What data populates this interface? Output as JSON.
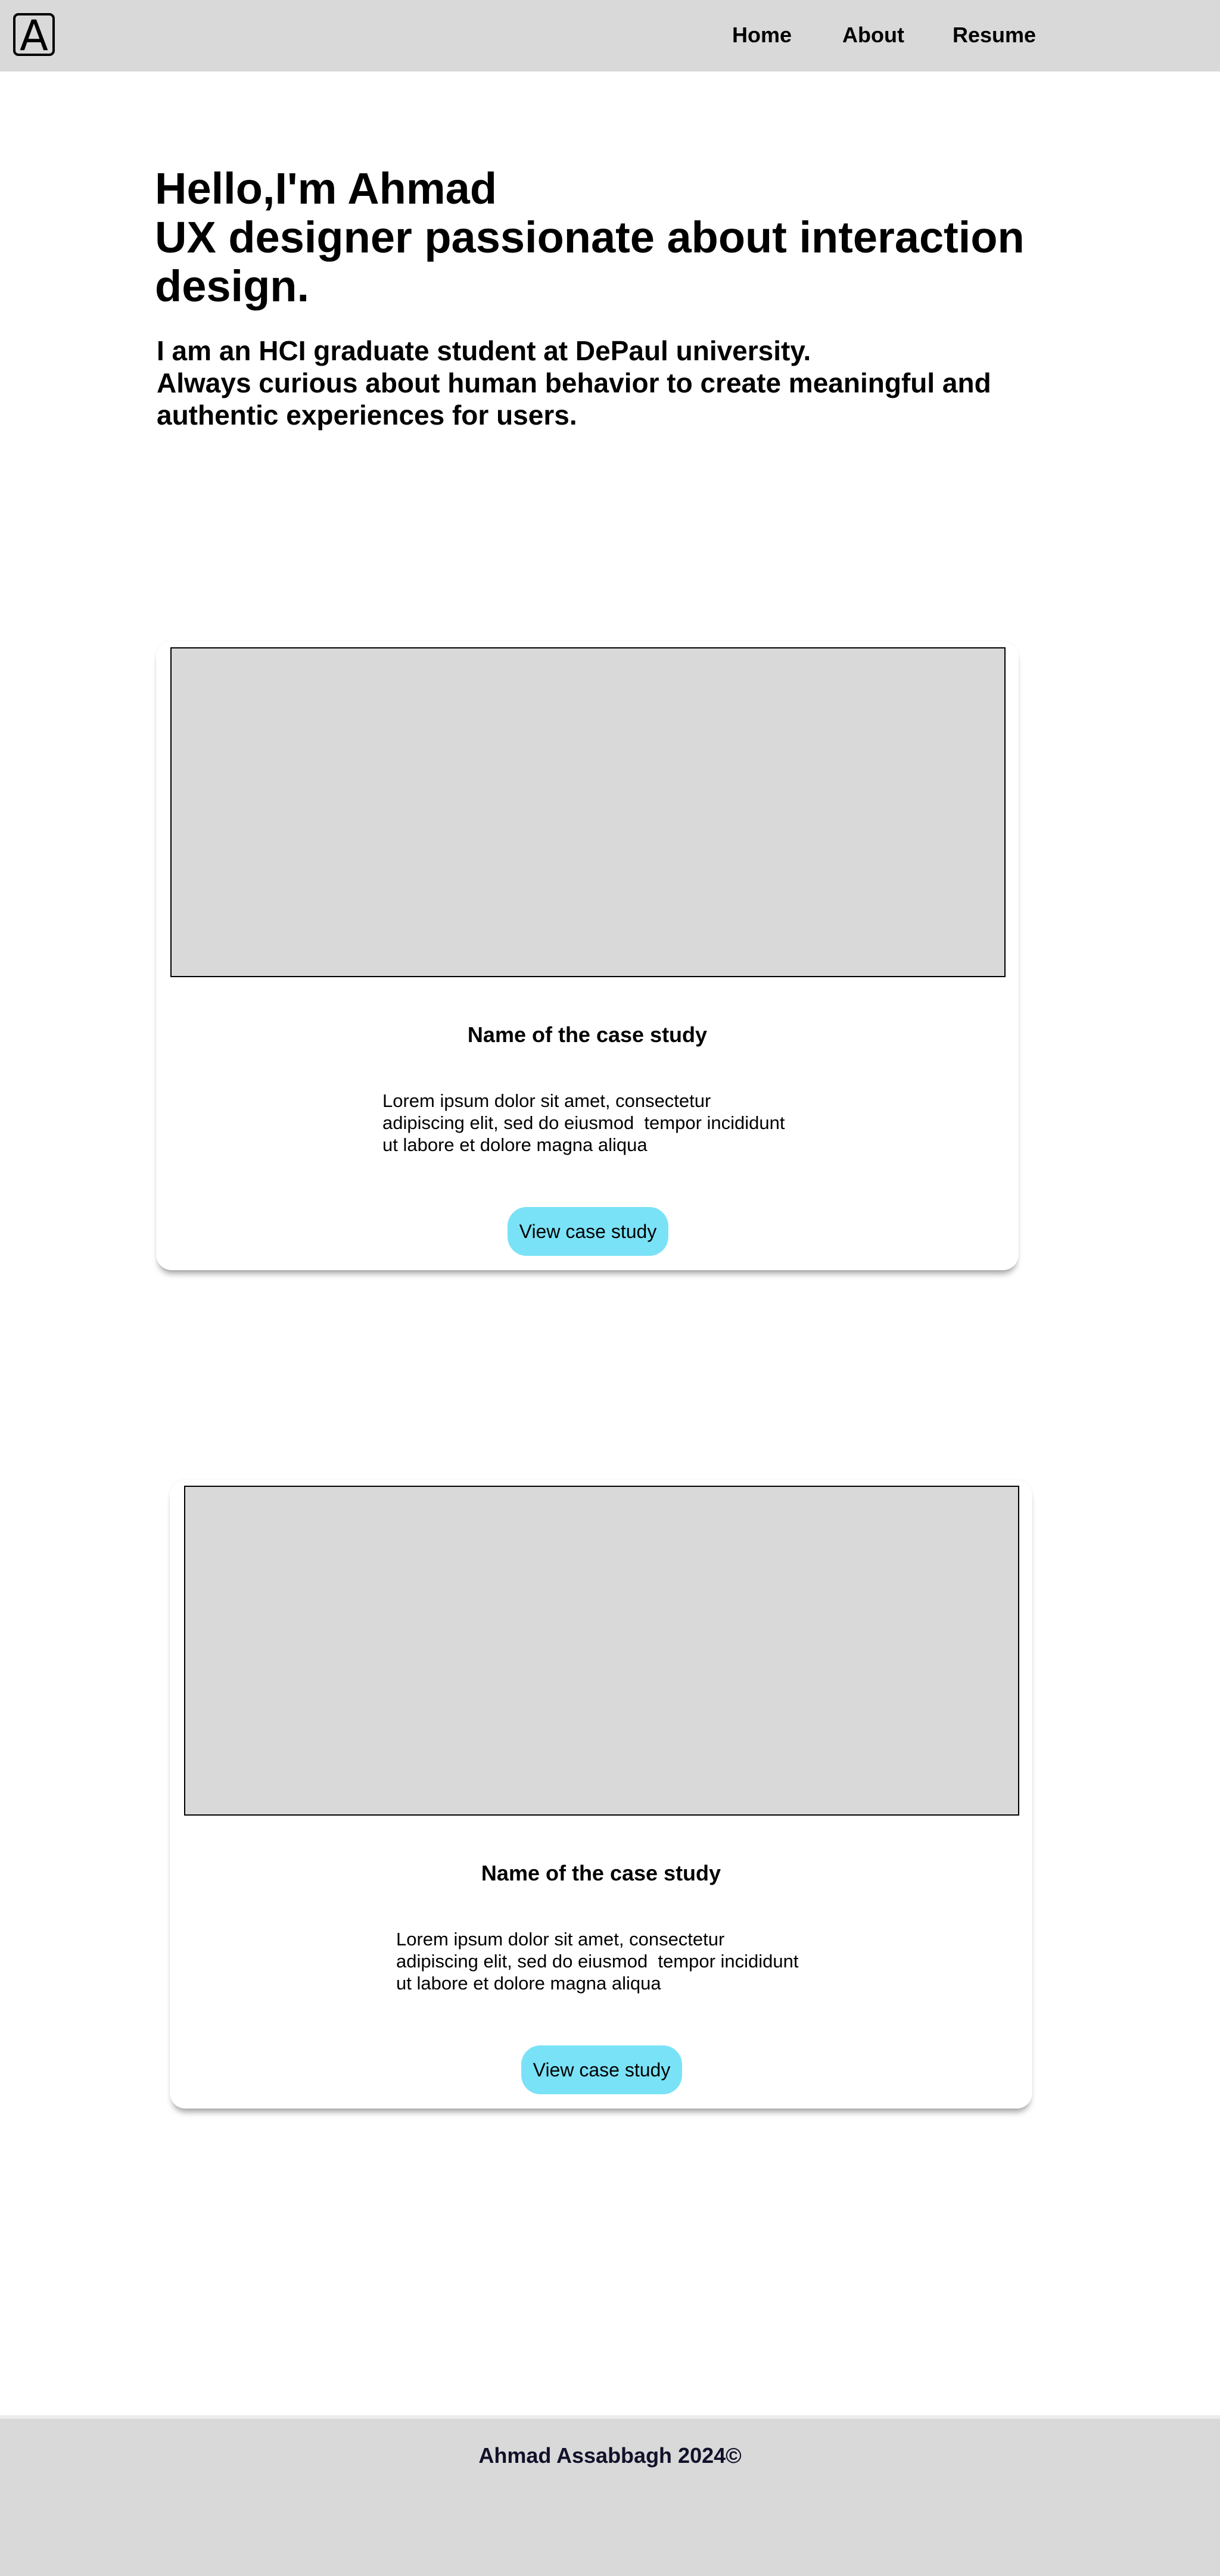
{
  "header": {
    "logo_letter": "A",
    "nav": {
      "home": "Home",
      "about": "About",
      "resume": "Resume"
    }
  },
  "hero": {
    "title_lines": [
      "Hello,I'm Ahmad",
      "UX designer passionate about interaction",
      "design."
    ],
    "subtitle_lines": [
      "I am an HCI graduate student at DePaul university.",
      "Always curious about human behavior to create meaningful and",
      "authentic experiences for users."
    ]
  },
  "case_studies": [
    {
      "title": "Name of the case study",
      "description_lines": [
        "Lorem ipsum dolor sit amet, consectetur",
        "adipiscing elit, sed do eiusmod  tempor incididunt",
        "ut labore et dolore magna aliqua"
      ],
      "button_label": "View case study"
    },
    {
      "title": "Name of the case study",
      "description_lines": [
        "Lorem ipsum dolor sit amet, consectetur",
        "adipiscing elit, sed do eiusmod  tempor incididunt",
        "ut labore et dolore magna aliqua"
      ],
      "button_label": "View case study"
    }
  ],
  "footer": {
    "text": "Ahmad Assabbagh 2024©"
  },
  "colors": {
    "header_bg": "#d9d9d9",
    "footer_bg": "#d9d9d9",
    "image_placeholder": "#d9d9d9",
    "button_bg": "#7ae2f7",
    "footer_text": "#11112a"
  }
}
